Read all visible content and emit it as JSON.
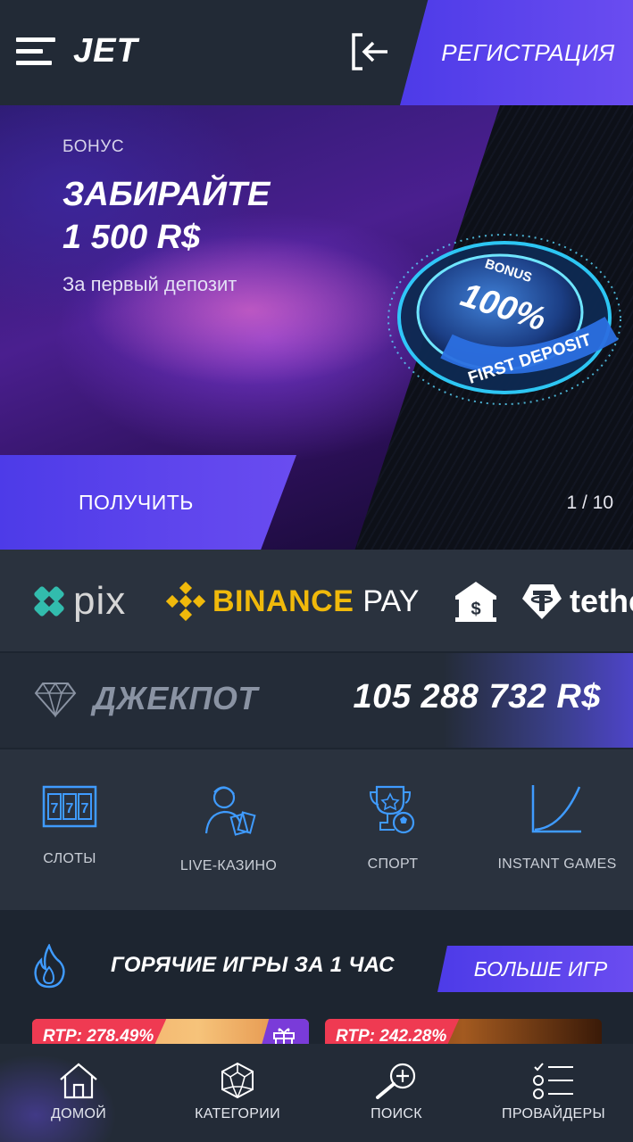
{
  "header": {
    "logo": "JET",
    "register_label": "РЕГИСТРАЦИЯ",
    "icons": [
      "menu-icon",
      "login-icon"
    ]
  },
  "banner": {
    "tag": "БОНУС",
    "title_line1": "ЗАБИРАЙТЕ",
    "title_line2": "1 500 R$",
    "subtitle": "За первый депозит",
    "coin_top": "BONUS",
    "coin_main": "100%",
    "coin_bottom": "FIRST DEPOSIT",
    "button_label": "ПОЛУЧИТЬ",
    "counter": "1 / 10"
  },
  "payments": {
    "pix": "pix",
    "binance": "BINANCE",
    "binance_pay": "PAY",
    "tether": "tethe"
  },
  "jackpot": {
    "label": "ДЖЕКПОТ",
    "value": "105 288 732 R$"
  },
  "categories": [
    {
      "label": "СЛОТЫ",
      "icon": "slots-icon"
    },
    {
      "label": "LIVE-КАЗИНО",
      "icon": "live-casino-icon"
    },
    {
      "label": "СПОРТ",
      "icon": "sport-trophy-icon"
    },
    {
      "label": "INSTANT GAMES",
      "icon": "instant-games-icon"
    }
  ],
  "hot_games": {
    "title": "ГОРЯЧИЕ ИГРЫ ЗА 1 ЧАС",
    "more_label": "БОЛЬШЕ ИГР",
    "cards": [
      {
        "rtp": "RTP: 278.49%"
      },
      {
        "rtp": "RTP: 242.28%"
      }
    ]
  },
  "bottom_nav": [
    {
      "label": "ДОМОЙ",
      "icon": "home-icon"
    },
    {
      "label": "КАТЕГОРИИ",
      "icon": "categories-icon"
    },
    {
      "label": "ПОИСК",
      "icon": "search-icon"
    },
    {
      "label": "ПРОВАЙДЕРЫ",
      "icon": "providers-icon"
    }
  ],
  "colors": {
    "accent": "#5b45ee",
    "background": "#1d2530",
    "panel": "#2a323e",
    "rtp_badge": "#ef3a52",
    "binance_yellow": "#f0b90b",
    "pix_teal": "#32bcad",
    "icon_blue": "#3f9bff"
  }
}
